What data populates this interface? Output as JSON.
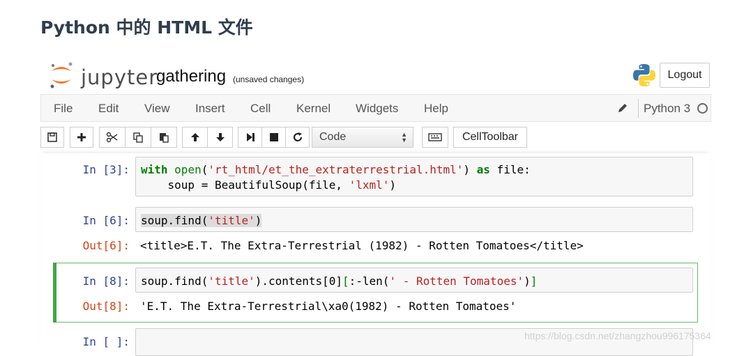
{
  "page": {
    "heading": "Python 中的 HTML 文件"
  },
  "header": {
    "logo_text": "jupyter",
    "notebook_title": "gathering",
    "save_status": "(unsaved changes)",
    "logout_label": "Logout"
  },
  "menubar": {
    "items": [
      "File",
      "Edit",
      "View",
      "Insert",
      "Cell",
      "Kernel",
      "Widgets",
      "Help"
    ],
    "kernel_name": "Python 3"
  },
  "toolbar": {
    "cell_type": "Code",
    "celltoolbar_label": "CellToolbar",
    "buttons": [
      "save-icon",
      "plus-icon",
      "scissors-icon",
      "copy-icon",
      "paste-icon",
      "arrow-up-icon",
      "arrow-down-icon",
      "step-forward-icon",
      "stop-icon",
      "restart-icon",
      "keyboard-icon"
    ]
  },
  "cells": [
    {
      "in_prompt": "In [3]:",
      "code": [
        [
          [
            "kw",
            "with"
          ],
          [
            "t",
            " "
          ],
          [
            "bi",
            "open"
          ],
          [
            "t",
            "("
          ],
          [
            "str",
            "'rt_html/et_the_extraterrestrial.html'"
          ],
          [
            "t",
            ") "
          ],
          [
            "kw",
            "as"
          ],
          [
            "t",
            " file:"
          ]
        ],
        [
          [
            "t",
            "    soup = BeautifulSoup(file, "
          ],
          [
            "str",
            "'lxml'"
          ],
          [
            "t",
            ")"
          ]
        ]
      ]
    },
    {
      "in_prompt": "In [6]:",
      "code": [
        [
          [
            "hl",
            "soup.find("
          ],
          [
            "hlstr",
            "'title'"
          ],
          [
            "hl",
            ")"
          ]
        ]
      ],
      "out_prompt": "Out[6]:",
      "output": "<title>E.T. The Extra-Terrestrial (1982) - Rotten Tomatoes</title>"
    },
    {
      "in_prompt": "In [8]:",
      "code": [
        [
          [
            "t",
            "soup.find("
          ],
          [
            "str",
            "'title'"
          ],
          [
            "t",
            ").contents[0]"
          ],
          [
            "bm",
            "["
          ],
          [
            "t",
            ":-len("
          ],
          [
            "str",
            "' - Rotten Tomatoes'"
          ],
          [
            "t",
            ")"
          ],
          [
            "bm",
            "]"
          ]
        ]
      ],
      "out_prompt": "Out[8]:",
      "output": "'E.T. The Extra-Terrestrial\\xa0(1982) - Rotten Tomatoes'"
    },
    {
      "in_prompt": "In [ ]:",
      "code": []
    }
  ],
  "watermark": "https://blog.csdn.net/zhangzhou996175364",
  "colors": {
    "in_prompt": "#303f9f",
    "out_prompt": "#d84315",
    "keyword": "#008000",
    "string": "#ba2121",
    "selected_cell": "#42a545"
  }
}
